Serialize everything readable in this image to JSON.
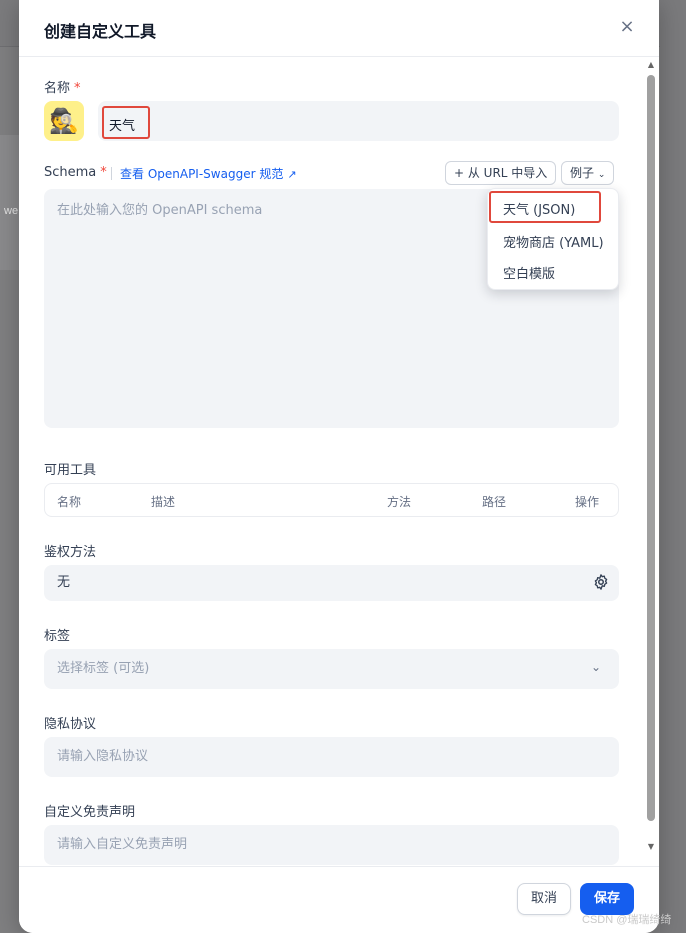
{
  "background": {
    "snippet": "we"
  },
  "modal": {
    "title": "创建自定义工具",
    "close_icon": "×"
  },
  "name_field": {
    "label": "名称",
    "required_mark": "*",
    "avatar_emoji": "🕵️",
    "value": "天气"
  },
  "schema": {
    "label": "Schema",
    "required_mark": "*",
    "spec_link": "查看 OpenAPI-Swagger 规范",
    "import_button": "+ 从 URL 中导入",
    "examples_button": "例子",
    "placeholder": "在此处输入您的 OpenAPI schema",
    "examples_menu": [
      "天气 (JSON)",
      "宠物商店 (YAML)",
      "空白模版"
    ]
  },
  "tools": {
    "label": "可用工具",
    "columns": [
      "名称",
      "描述",
      "方法",
      "路径",
      "操作"
    ]
  },
  "auth": {
    "label": "鉴权方法",
    "value": "无"
  },
  "tags": {
    "label": "标签",
    "placeholder": "选择标签 (可选)"
  },
  "privacy": {
    "label": "隐私协议",
    "placeholder": "请输入隐私协议"
  },
  "disclaimer": {
    "label": "自定义免责声明",
    "placeholder": "请输入自定义免责声明"
  },
  "footer": {
    "cancel": "取消",
    "save": "保存"
  },
  "watermark": "CSDN @瑞瑞绮绮",
  "colors": {
    "primary": "#155eef",
    "required": "#f04438",
    "highlight": "#e0483c",
    "input_bg": "#f2f4f7"
  }
}
